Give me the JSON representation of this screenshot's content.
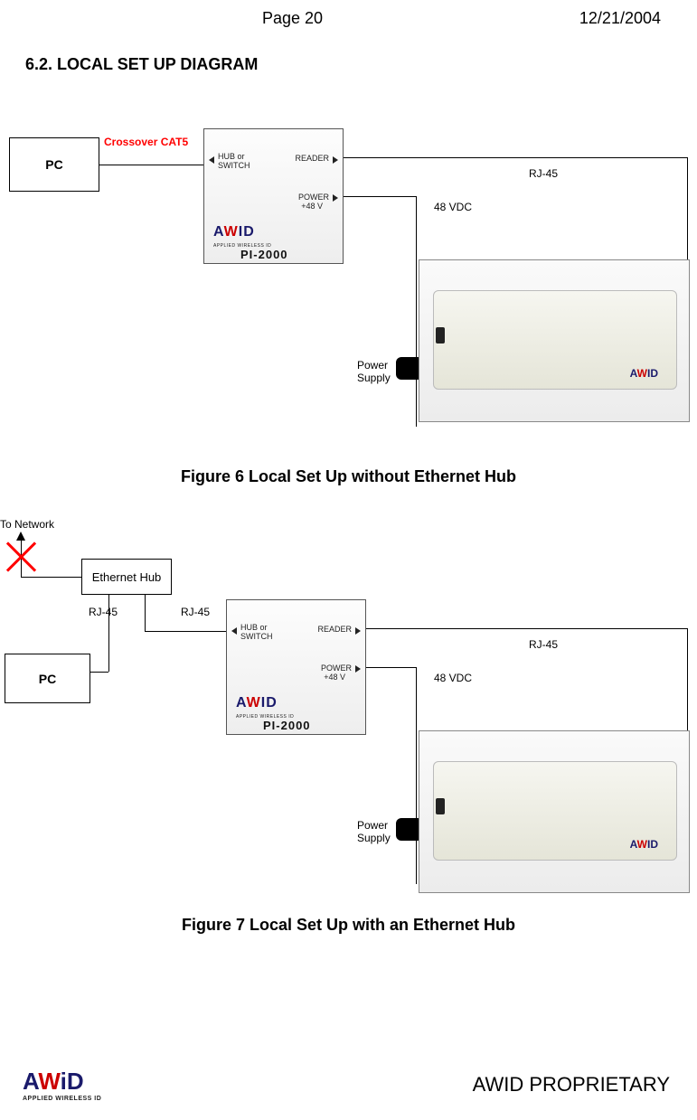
{
  "header": {
    "page_num": "Page 20",
    "date": "12/21/2004"
  },
  "section": {
    "title": "6.2. LOCAL SET UP DIAGRAM"
  },
  "diagram1": {
    "pc": "PC",
    "crossover": "Crossover CAT5",
    "pi2000": {
      "hub_switch": "HUB or SWITCH",
      "reader": "READER",
      "power": "POWER",
      "vdc": "+48 V",
      "brand": "AWID",
      "brand_sub": "APPLIED WIRELESS ID",
      "model": "PI-2000"
    },
    "rj45": "RJ-45",
    "vdc48": "48 VDC",
    "power_supply": "Power\nSupply",
    "reader_brand": "AWID",
    "caption": "Figure 6 Local Set Up without Ethernet Hub"
  },
  "diagram2": {
    "to_network": "To Network",
    "ethernet_hub": "Ethernet Hub",
    "rj45_a": "RJ-45",
    "rj45_b": "RJ-45",
    "pc": "PC",
    "pi2000": {
      "hub_switch": "HUB or SWITCH",
      "reader": "READER",
      "power": "POWER",
      "vdc": "+48 V",
      "brand": "AWID",
      "brand_sub": "APPLIED WIRELESS ID",
      "model": "PI-2000"
    },
    "rj45_c": "RJ-45",
    "vdc48": "48 VDC",
    "power_supply": "Power\nSupply",
    "reader_brand": "AWID",
    "caption": "Figure 7 Local Set Up with an Ethernet Hub"
  },
  "footer": {
    "brand": "AWID",
    "brand_sub": "APPLIED WIRELESS ID",
    "proprietary": "AWID PROPRIETARY"
  }
}
